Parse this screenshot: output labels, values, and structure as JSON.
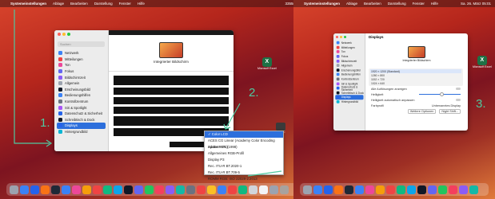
{
  "left_menubar": {
    "apple": "",
    "app": "Systemeinstellungen",
    "items": [
      "Ablage",
      "Bearbeiten",
      "Darstellung",
      "Fenster",
      "Hilfe"
    ],
    "status": "3355rpm | 49°C"
  },
  "right_menubar": {
    "apple": "",
    "app": "Systemeinstellungen",
    "items": [
      "Ablage",
      "Bearbeiten",
      "Darstellung",
      "Fenster",
      "Hilfe"
    ],
    "status": "Sa. 26. März 05:01"
  },
  "desktop": {
    "excel_label": "Microsoft Excel",
    "left_bottom_label": "OpenC"
  },
  "left_window": {
    "search_placeholder": "Suchen",
    "sidebar": [
      "Netzwerk",
      "Mitteilungen",
      "Ton",
      "Fokus",
      "Bildschirmzeit",
      "Allgemein",
      "Erscheinungsbild",
      "Bedienungshilfen",
      "Kontrollzentrum",
      "Siri & Spotlight",
      "Datenschutz & Sicherheit",
      "Schreibtisch & Dock",
      "Displays",
      "Hintergrundbild"
    ],
    "selected": "Displays",
    "display_name": "Integrierter Bildschirm"
  },
  "dropdown": {
    "options": [
      "Color LCD",
      "ACES CG Linear (Academy Color Encoding System AP1)",
      "Adobe RGB (1998)",
      "Allgemeines RGB-Profil",
      "Display P3",
      "Rec. ITU-R BT.2020-1",
      "Rec. ITU-R BT.709-5",
      "ROMM RGB: ISO 22028-2:2013"
    ],
    "selected": "Color LCD"
  },
  "annotations": {
    "step1": "1.",
    "step2": "2.",
    "step3": "3."
  },
  "right_window": {
    "title": "Displays",
    "display_name": "Integrierter Bildschirm",
    "resolutions": [
      "1920 × 1200 (Standard)",
      "1280 × 800",
      "1152 × 720",
      "1024 × 640"
    ],
    "show_all": "Alle Auflösungen anzeigen",
    "brightness": "Helligkeit",
    "auto_brightness": "Helligkeit automatisch anpassen",
    "color_profile": "Farbprofil",
    "color_profile_value": "Unbenanntes Display",
    "night_shift": "Night Shift...",
    "advanced": "Weitere Optionen",
    "sidebar": [
      "Netzwerk",
      "Mitteilungen",
      "Ton",
      "Fokus",
      "Bildschirmzeit",
      "Allgemein",
      "Erscheinungsbild",
      "Bedienungshilfen",
      "Kontrollzentrum",
      "Siri & Spotlight",
      "Datenschutz & Sicherheit",
      "Schreibtisch & Dock",
      "Displays",
      "Hintergrundbild"
    ],
    "selected": "Displays"
  }
}
